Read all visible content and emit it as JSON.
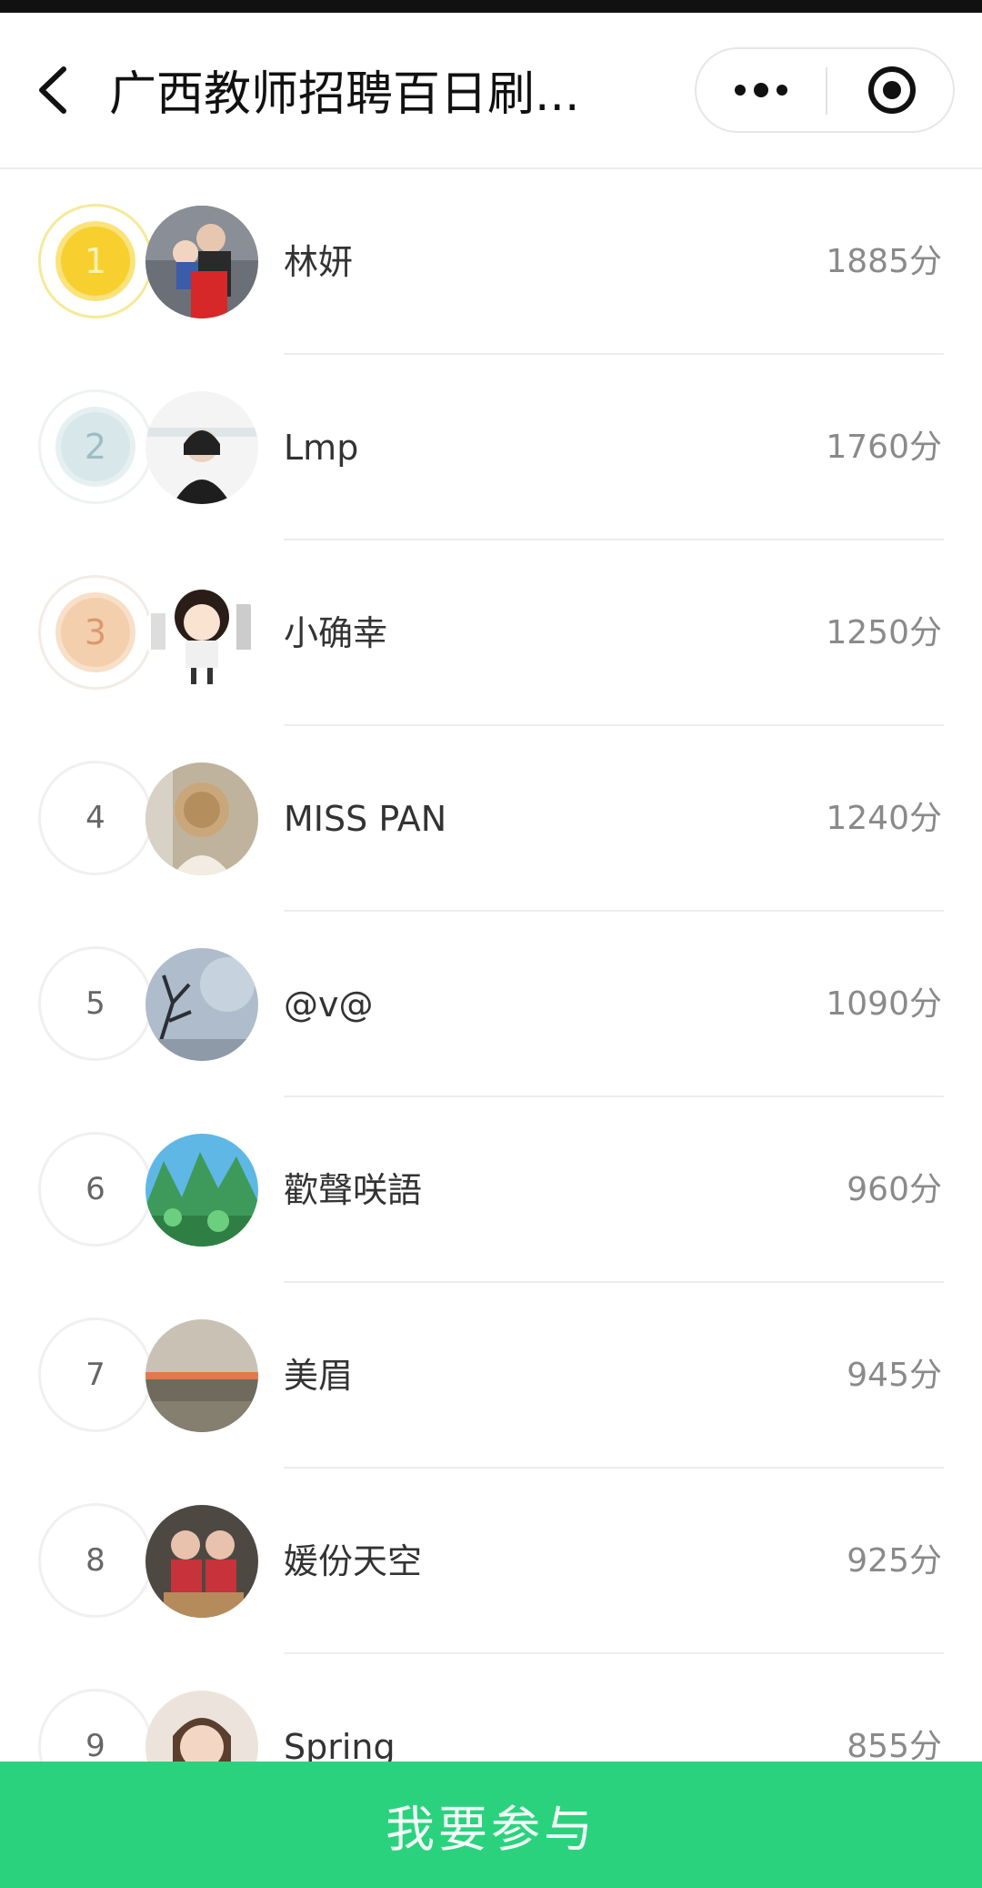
{
  "header": {
    "title": "广西教师招聘百日刷..."
  },
  "leaderboard": [
    {
      "rank": "1",
      "name": "林妍",
      "score": "1885分"
    },
    {
      "rank": "2",
      "name": "Lmp",
      "score": "1760分"
    },
    {
      "rank": "3",
      "name": "小确幸",
      "score": "1250分"
    },
    {
      "rank": "4",
      "name": "MISS PAN",
      "score": "1240分"
    },
    {
      "rank": "5",
      "name": "@v@",
      "score": "1090分"
    },
    {
      "rank": "6",
      "name": "歡聲咲語",
      "score": "960分"
    },
    {
      "rank": "7",
      "name": "美眉",
      "score": "945分"
    },
    {
      "rank": "8",
      "name": "媛份天空",
      "score": "925分"
    },
    {
      "rank": "9",
      "name": "Spring",
      "score": "855分"
    }
  ],
  "footer": {
    "join_label": "我要参与"
  },
  "colors": {
    "accent": "#2bd27d",
    "gold": "#f7cf2f",
    "silver": "#d8e7ea",
    "bronze": "#f4cfad"
  }
}
